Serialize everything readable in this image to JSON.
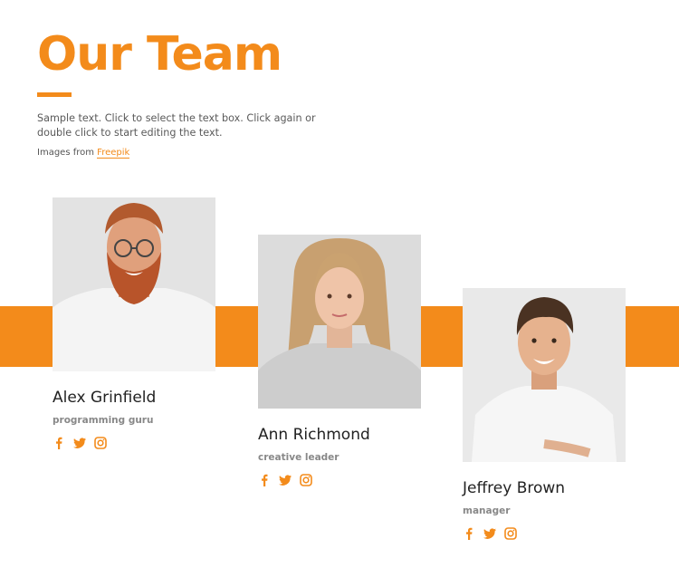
{
  "header": {
    "title": "Our Team",
    "intro": "Sample text. Click to select the text box. Click again or double click to start editing the text.",
    "credit_prefix": "Images from ",
    "credit_link": "Freepik"
  },
  "team": [
    {
      "name": "Alex Grinfield",
      "role": "programming guru"
    },
    {
      "name": "Ann Richmond",
      "role": "creative leader"
    },
    {
      "name": "Jeffrey Brown",
      "role": "manager"
    }
  ],
  "colors": {
    "accent": "#f38b1b"
  },
  "icons": [
    "facebook-icon",
    "twitter-icon",
    "instagram-icon"
  ]
}
